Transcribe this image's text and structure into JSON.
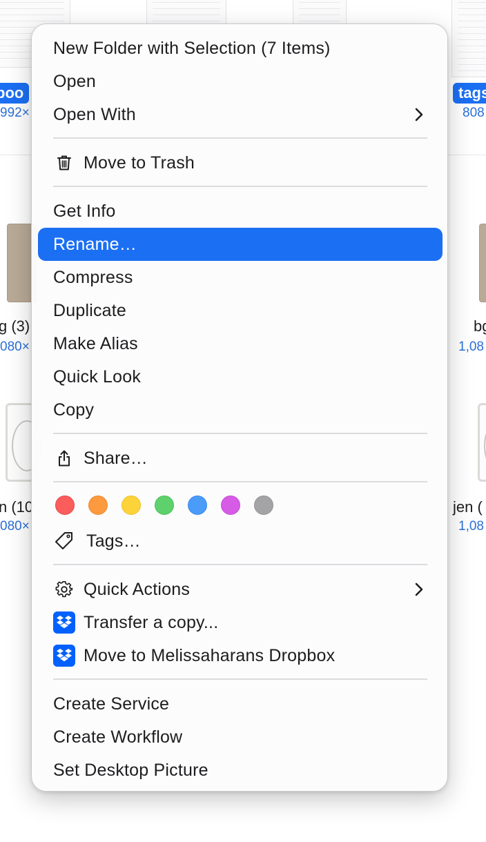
{
  "background": {
    "top_row": {
      "left_label": "boo",
      "left_size": "992×",
      "right_label": "tags",
      "right_size": "808"
    },
    "mid_row": {
      "left_label": "g (3)",
      "left_size": "080×",
      "right_label": "bg",
      "right_size": "1,08"
    },
    "bottom_row": {
      "left_label": "n (10",
      "left_size": "080×",
      "right_label": "jen (",
      "right_size": "1,08"
    }
  },
  "menu": {
    "group1": {
      "new_folder": "New Folder with Selection (7 Items)",
      "open": "Open",
      "open_with": "Open With"
    },
    "group2": {
      "move_to_trash": "Move to Trash"
    },
    "group3": {
      "get_info": "Get Info",
      "rename": "Rename…",
      "compress": "Compress",
      "duplicate": "Duplicate",
      "make_alias": "Make Alias",
      "quick_look": "Quick Look",
      "copy": "Copy"
    },
    "group4": {
      "share": "Share…"
    },
    "tags": {
      "colors": [
        {
          "name": "red",
          "fill": "#fb5d5d",
          "border": "#e24a4a"
        },
        {
          "name": "orange",
          "fill": "#fd9a3f",
          "border": "#ea8a33"
        },
        {
          "name": "yellow",
          "fill": "#fdd33a",
          "border": "#ebc12b"
        },
        {
          "name": "green",
          "fill": "#5ed16c",
          "border": "#4cbf5b"
        },
        {
          "name": "blue",
          "fill": "#4b9cf8",
          "border": "#3a8ae6"
        },
        {
          "name": "purple",
          "fill": "#d65ce6",
          "border": "#c44bd4"
        },
        {
          "name": "gray",
          "fill": "#a4a4a7",
          "border": "#939396"
        }
      ],
      "label": "Tags…"
    },
    "group5": {
      "quick_actions": "Quick Actions",
      "transfer_copy": "Transfer a copy...",
      "move_to_dropbox": "Move to Melissaharans Dropbox"
    },
    "group6": {
      "create_service": "Create Service",
      "create_workflow": "Create Workflow",
      "set_desktop_picture": "Set Desktop Picture"
    },
    "highlight_color": "#1b6ff3",
    "dropbox_color": "#0061fe"
  }
}
